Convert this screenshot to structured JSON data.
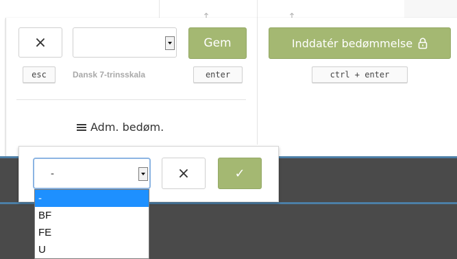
{
  "grade_panel": {
    "cancel_icon": "×",
    "cancel_key": "esc",
    "scale_select_value": "",
    "scale_label": "Dansk 7-trinsskala",
    "save_label": "Gem",
    "save_key": "enter",
    "submit_label": "Inddatér bedømmelse",
    "submit_icon": "lock-icon",
    "submit_key": "ctrl + enter",
    "admin_label": "Adm. bedøm."
  },
  "row_editor": {
    "select_value": "-",
    "cancel_icon": "×",
    "confirm_icon": "✓",
    "options": [
      "-",
      "BF",
      "FE",
      "U"
    ],
    "selected_index": 0
  },
  "colors": {
    "accent_green": "#a4b872",
    "selection_blue": "#1e90ff",
    "dark_background": "#4a4a4a",
    "row_border_blue": "#4c7fa7"
  }
}
